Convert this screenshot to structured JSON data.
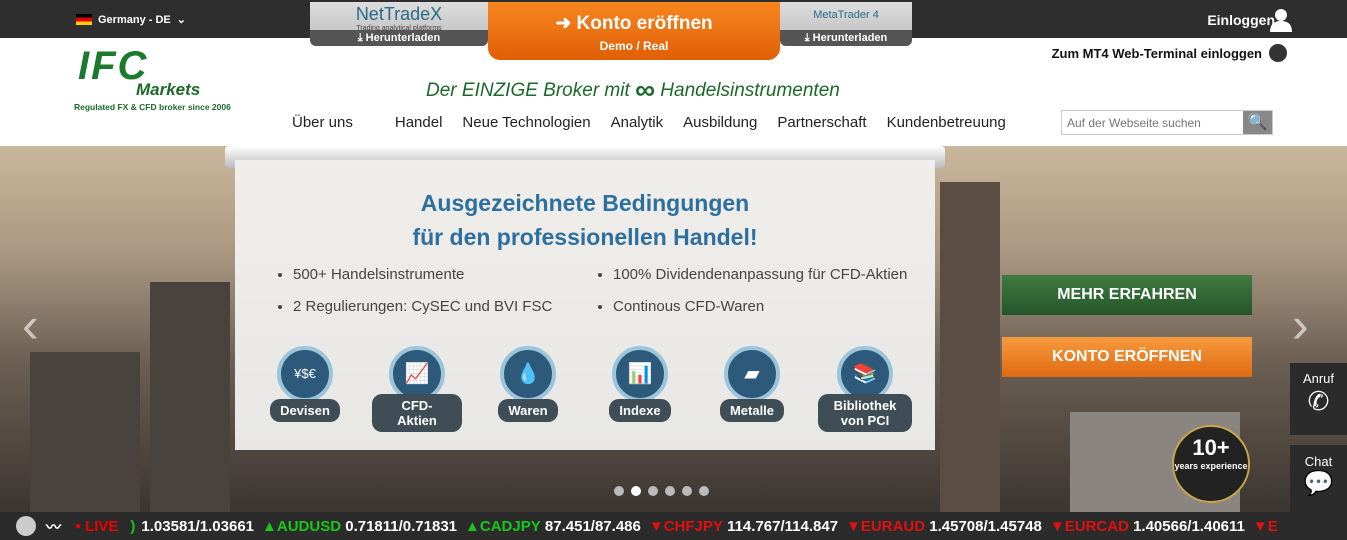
{
  "topbar": {
    "country": "Germany - DE",
    "nettradex": {
      "logo": "NetTradeX",
      "sub": "Trading analytical platforms",
      "download": "Herunterladen"
    },
    "konto": {
      "title": "Konto eröffnen",
      "sub": "Demo / Real"
    },
    "mt4": {
      "logo": "MetaTrader 4",
      "download": "Herunterladen"
    },
    "login": "Einloggen"
  },
  "header": {
    "mt4_link": "Zum MT4 Web-Terminal einloggen",
    "logo": {
      "ifc": "IFC",
      "markets": "Markets",
      "tagline": "Regulated FX & CFD broker since 2006"
    },
    "slogan_pre": "Der EINZIGE Broker mit",
    "slogan_post": "Handelsinstrumenten",
    "nav": [
      "Über uns",
      "Handel",
      "Neue Technologien",
      "Analytik",
      "Ausbildung",
      "Partnerschaft",
      "Kundenbetreuung"
    ],
    "search_placeholder": "Auf der Webseite suchen"
  },
  "hero": {
    "title1": "Ausgezeichnete Bedingungen",
    "title2": "für den professionellen Handel!",
    "left": [
      "500+ Handelsinstrumente",
      "2 Regulierungen: CySEC und BVI FSC"
    ],
    "right": [
      "100% Dividendenanpassung für CFD-Aktien",
      "Continous CFD-Waren"
    ],
    "categories": [
      {
        "label": "Devisen",
        "icon": "¥$€"
      },
      {
        "label": "CFD-Aktien",
        "icon": "📈"
      },
      {
        "label": "Waren",
        "icon": "💧"
      },
      {
        "label": "Indexe",
        "icon": "📊"
      },
      {
        "label": "Metalle",
        "icon": "▰"
      },
      {
        "label": "Bibliothek von PCI",
        "icon": "📚"
      }
    ],
    "more": "MEHR ERFAHREN",
    "open": "KONTO ERÖFFNEN",
    "badge": "10+",
    "badge_sub": "years experience",
    "active_slide": 2,
    "slides": 6
  },
  "side": {
    "call": "Anruf",
    "chat": "Chat"
  },
  "ticker": {
    "live": "LIVE",
    "quotes": [
      {
        "sym": "",
        "q": "1.03581/1.03661",
        "dir": "up"
      },
      {
        "sym": "AUDUSD",
        "q": "0.71811/0.71831",
        "dir": "up"
      },
      {
        "sym": "CADJPY",
        "q": "87.451/87.486",
        "dir": "up"
      },
      {
        "sym": "CHFJPY",
        "q": "114.767/114.847",
        "dir": "down"
      },
      {
        "sym": "EURAUD",
        "q": "1.45708/1.45748",
        "dir": "down"
      },
      {
        "sym": "EURCAD",
        "q": "1.40566/1.40611",
        "dir": "down"
      },
      {
        "sym": "E",
        "q": "",
        "dir": "down"
      }
    ]
  }
}
